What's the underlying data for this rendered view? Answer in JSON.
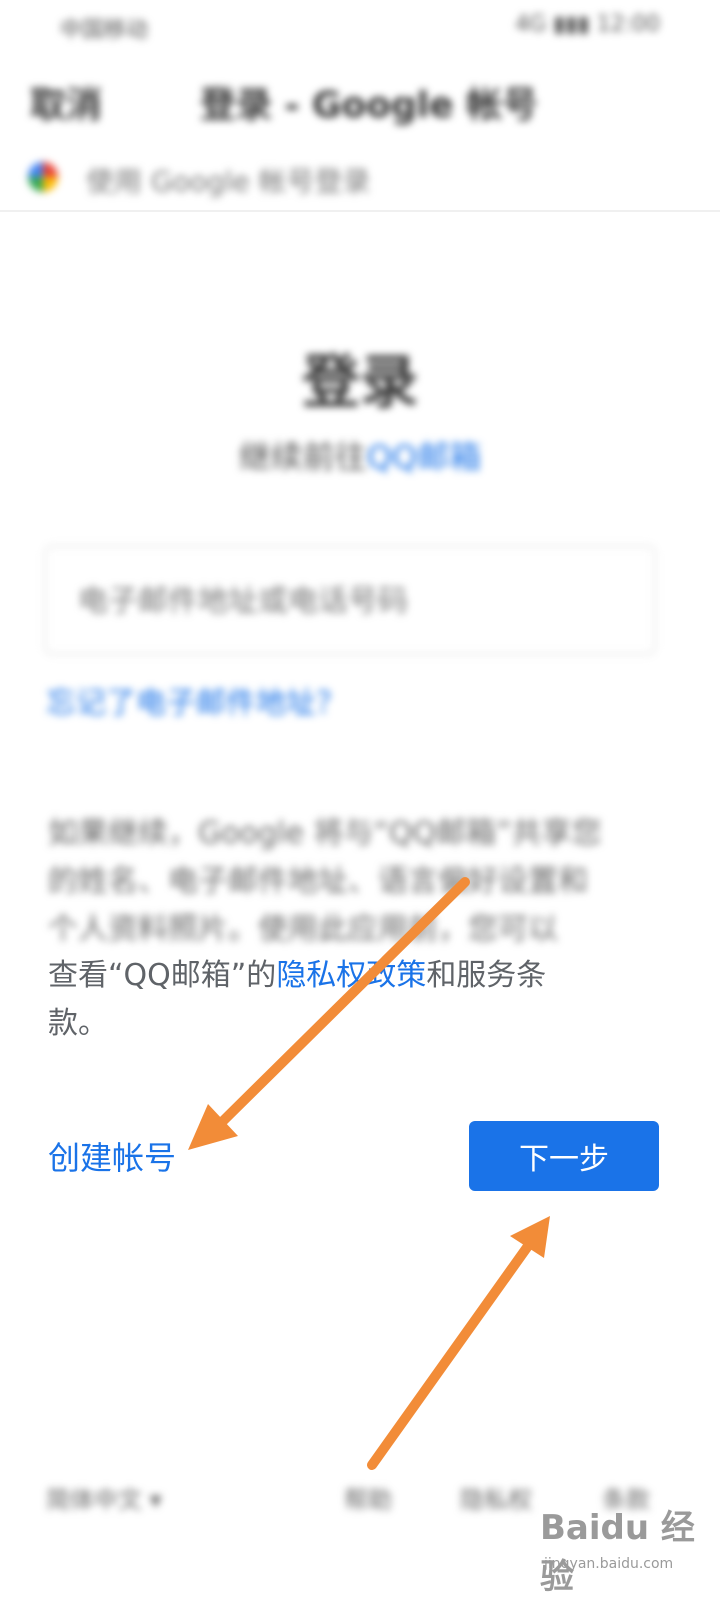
{
  "status_bar": {
    "left": "中国移动",
    "right": "4G  ▮▮▮  12:00"
  },
  "appbar": {
    "cancel_label": "取消",
    "title": "登录 - Google 帐号"
  },
  "site_row": {
    "text": "使用 Google 帐号登录"
  },
  "signin": {
    "heading": "登录",
    "subtitle_prefix": "继续前往",
    "subtitle_link": "QQ邮箱",
    "email_placeholder": "电子邮件地址或电话号码",
    "forgot_email": "忘记了电子邮件地址？"
  },
  "notice": {
    "blurred_lines": [
      "如果继续，Google 将与“QQ邮箱”共享您",
      "的姓名、电子邮件地址、语言偏好设置和",
      "个人资料照片。使用此应用前，您可以"
    ],
    "view_prefix": "查看“QQ邮箱”的",
    "privacy_link": "隐私权政策",
    "and_terms": "和服务条",
    "terms_end": "款。"
  },
  "actions": {
    "create_account": "创建帐号",
    "next": "下一步"
  },
  "footer": {
    "language": "简体中文 ▾",
    "help": "帮助",
    "privacy": "隐私权",
    "terms": "条款"
  },
  "watermark": {
    "logo": "Baidu 经验",
    "url": "jingyan.baidu.com"
  },
  "colors": {
    "accent": "#1a73e8",
    "arrow": "#f28c38"
  }
}
